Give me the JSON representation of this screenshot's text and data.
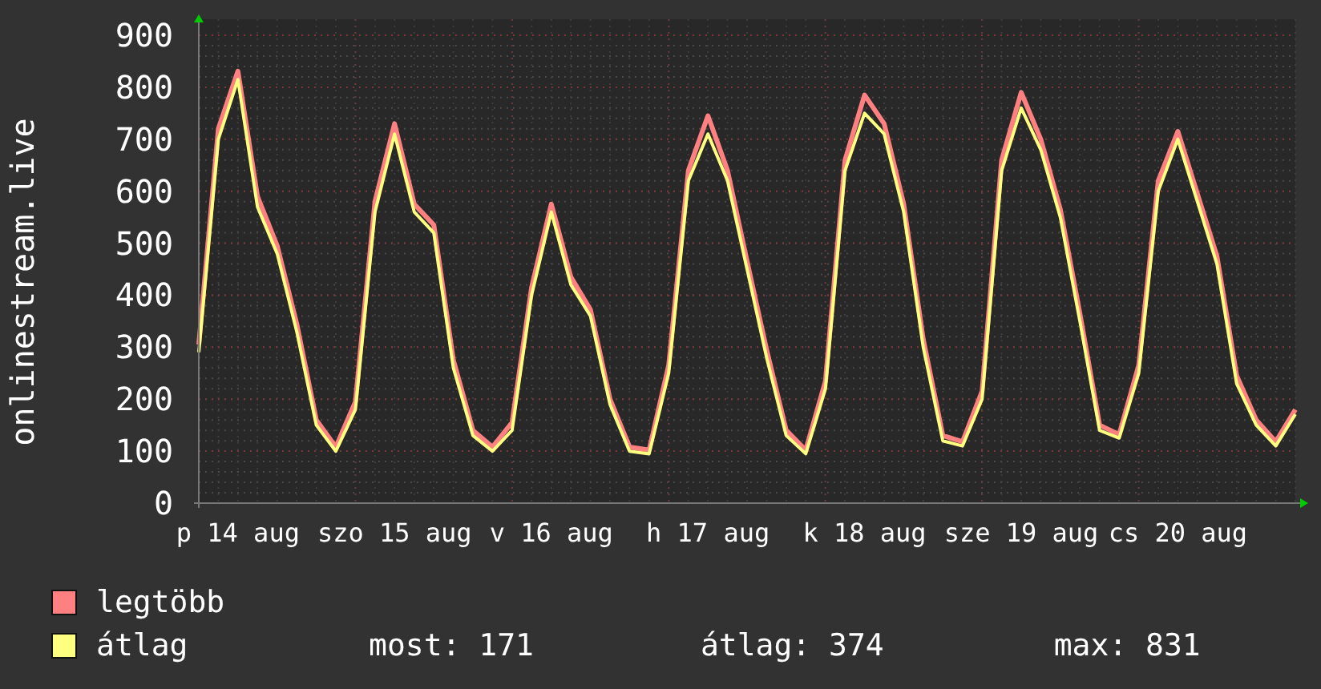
{
  "chart_data": {
    "type": "line",
    "ylabel": "onlinestream.live",
    "categories": [
      null,
      null,
      "p 14 aug",
      null,
      null,
      null,
      null,
      null,
      null,
      null,
      "szo 15 aug",
      null,
      null,
      null,
      null,
      null,
      null,
      null,
      "v 16 aug",
      null,
      null,
      null,
      null,
      null,
      null,
      null,
      "h 17 aug",
      null,
      null,
      null,
      null,
      null,
      null,
      null,
      "k 18 aug",
      null,
      null,
      null,
      null,
      null,
      null,
      null,
      "sze 19 aug",
      null,
      null,
      null,
      null,
      null,
      null,
      null,
      "cs 20 aug",
      null,
      null,
      null,
      null,
      null,
      null
    ],
    "ylim": [
      0,
      900
    ],
    "grid": true,
    "yticks": [
      0,
      100,
      200,
      300,
      400,
      500,
      600,
      700,
      800,
      900
    ],
    "series": [
      {
        "name": "legtöbb",
        "color": "#ff8080",
        "values": [
          305,
          720,
          831,
          590,
          495,
          345,
          160,
          108,
          195,
          580,
          730,
          575,
          535,
          275,
          140,
          108,
          155,
          415,
          575,
          435,
          372,
          200,
          108,
          102,
          265,
          640,
          745,
          640,
          465,
          295,
          140,
          102,
          235,
          660,
          785,
          730,
          575,
          315,
          130,
          118,
          215,
          660,
          790,
          700,
          565,
          365,
          150,
          132,
          265,
          620,
          715,
          595,
          475,
          245,
          160,
          118,
          180
        ]
      },
      {
        "name": "átlag",
        "color": "#ffff80",
        "values": [
          290,
          700,
          815,
          570,
          480,
          330,
          150,
          100,
          180,
          560,
          710,
          560,
          520,
          260,
          130,
          100,
          140,
          400,
          560,
          420,
          360,
          190,
          100,
          95,
          250,
          620,
          710,
          620,
          450,
          280,
          130,
          95,
          220,
          640,
          750,
          710,
          560,
          300,
          120,
          110,
          200,
          640,
          760,
          680,
          550,
          350,
          140,
          125,
          250,
          600,
          700,
          580,
          460,
          230,
          150,
          110,
          171
        ]
      }
    ]
  },
  "summary": [
    "most: 171",
    "átlag: 374",
    "max: 831"
  ]
}
